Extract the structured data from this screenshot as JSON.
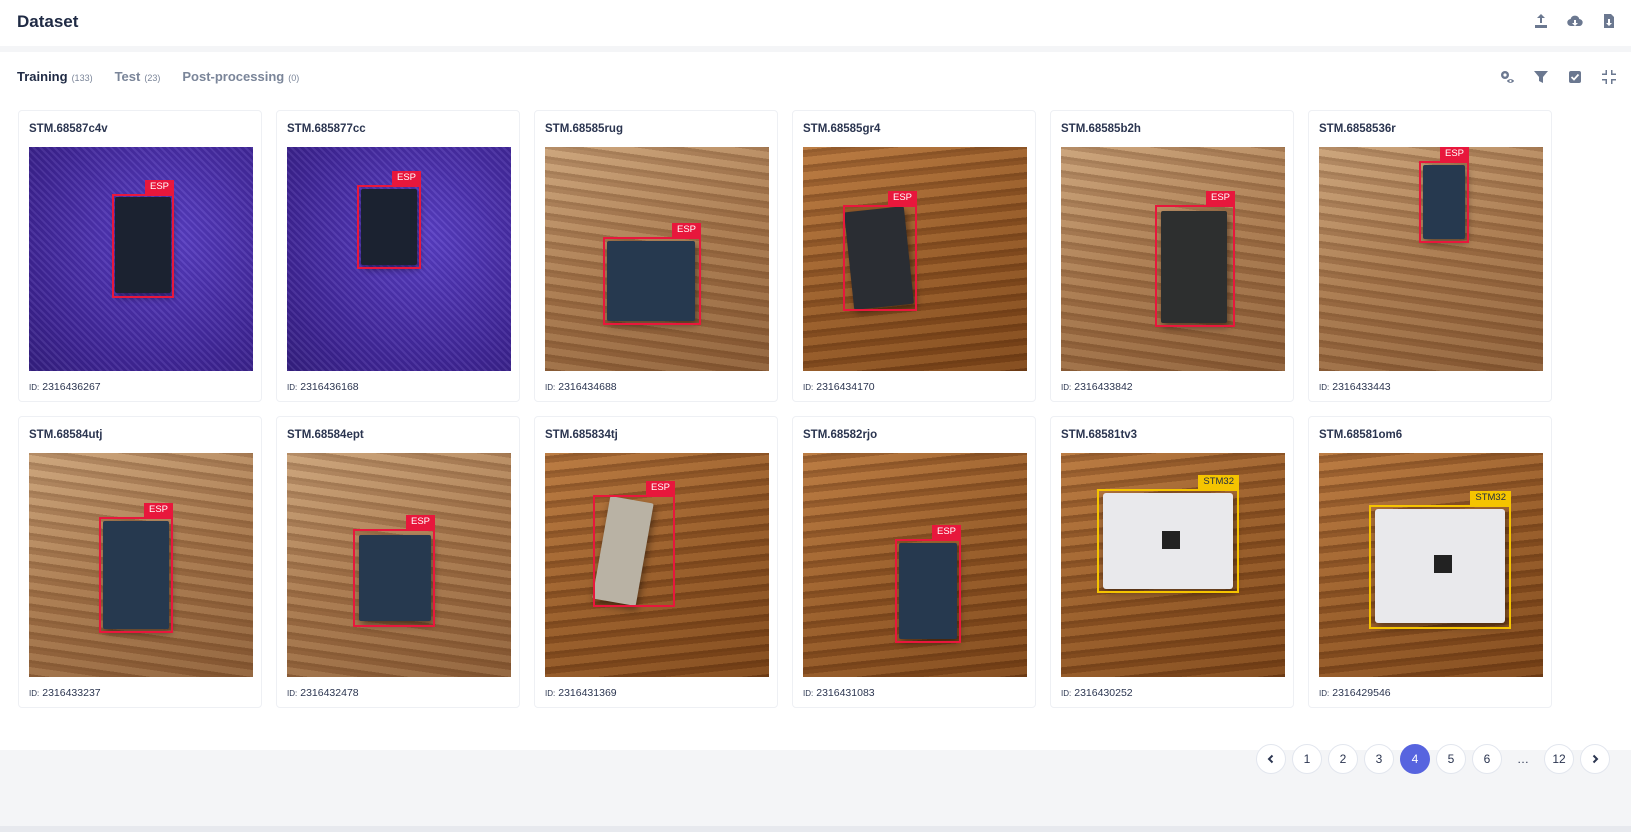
{
  "header": {
    "title": "Dataset"
  },
  "header_icons": [
    "upload-icon",
    "cloud-download-icon",
    "export-file-icon"
  ],
  "tabs": [
    {
      "label": "Training",
      "count": "(133)",
      "active": true
    },
    {
      "label": "Test",
      "count": "(23)",
      "active": false
    },
    {
      "label": "Post-processing",
      "count": "(0)",
      "active": false
    }
  ],
  "tab_tools": [
    "settings-eye-icon",
    "filter-icon",
    "select-check-icon",
    "collapse-icon"
  ],
  "id_prefix": "ID:",
  "cards": [
    {
      "name": "STM.68587c4v",
      "id": "2316436267",
      "label": "ESP"
    },
    {
      "name": "STM.685877cc",
      "id": "2316436168",
      "label": "ESP"
    },
    {
      "name": "STM.68585rug",
      "id": "2316434688",
      "label": "ESP"
    },
    {
      "name": "STM.68585gr4",
      "id": "2316434170",
      "label": "ESP"
    },
    {
      "name": "STM.68585b2h",
      "id": "2316433842",
      "label": "ESP"
    },
    {
      "name": "STM.6858536r",
      "id": "2316433443",
      "label": "ESP"
    },
    {
      "name": "STM.68584utj",
      "id": "2316433237",
      "label": "ESP"
    },
    {
      "name": "STM.68584ept",
      "id": "2316432478",
      "label": "ESP"
    },
    {
      "name": "STM.685834tj",
      "id": "2316431369",
      "label": "ESP"
    },
    {
      "name": "STM.68582rjo",
      "id": "2316431083",
      "label": "ESP"
    },
    {
      "name": "STM.68581tv3",
      "id": "2316430252",
      "label": "STM32"
    },
    {
      "name": "STM.68581om6",
      "id": "2316429546",
      "label": "STM32"
    }
  ],
  "colors": {
    "accent": "#5764df",
    "esp_box": "#e8173c",
    "stm32_box": "#f5c400"
  },
  "pagination": {
    "pages": [
      "1",
      "2",
      "3",
      "4",
      "5",
      "6",
      "…",
      "12"
    ],
    "current": "4"
  }
}
